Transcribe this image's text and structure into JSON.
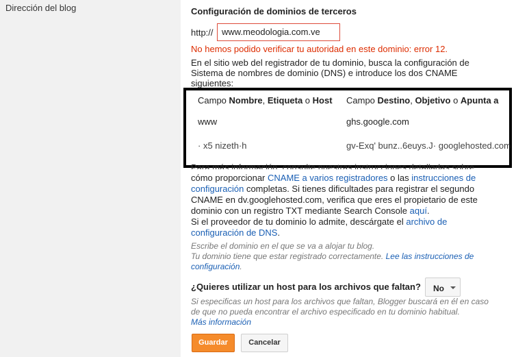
{
  "sidebar": {
    "label": "Dirección del blog"
  },
  "section": {
    "heading": "Configuración de dominios de terceros"
  },
  "domain": {
    "prefix": "http://",
    "value": "www.meodologia.com.ve"
  },
  "error": "No hemos podido verificar tu autoridad en este dominio: error 12.",
  "instructions": "En el sitio web del registrador de tu dominio, busca la configuración de Sistema de nombres de dominio (DNS) e introduce los dos CNAME siguientes:",
  "cname": {
    "header_name_prefix": "Campo ",
    "header_name_b1": "Nombre",
    "header_name_sep1": ", ",
    "header_name_b2": "Etiqueta",
    "header_name_sep2": " o ",
    "header_name_b3": "Host",
    "header_dest_prefix": "Campo ",
    "header_dest_b1": "Destino",
    "header_dest_sep1": ", ",
    "header_dest_b2": "Objetivo",
    "header_dest_sep2": " o ",
    "header_dest_b3": "Apunta a",
    "row1_name": "www",
    "row1_dest": "ghs.google.com",
    "row2_name": "· x5 nizeth·h",
    "row2_dest": "gv-Exq' bunz..6euys.J· googlehosted.com"
  },
  "more_info": {
    "cut_line": "Para más información, consulte nuestras instrucciones detalladas sobre",
    "text1": "cómo proporcionar ",
    "link1": "CNAME a varios registradores",
    "text2": " o las ",
    "link2": "instrucciones de configuración",
    "text3": " completas. Si tienes dificultades para registrar el segundo CNAME en dv.googlehosted.com, verifica que eres el propietario de este dominio con un registro TXT mediante Search Console ",
    "link3": "aquí",
    "text4": ".",
    "text5": "Si el proveedor de tu dominio lo admite, descárgate el ",
    "link4": "archivo de configuración de DNS",
    "text6": "."
  },
  "hint": {
    "line1": "Escribe el dominio en el que se va a alojar tu blog.",
    "line2": "Tu dominio tiene que estar registrado correctamente. ",
    "link": "Lee las instrucciones de configuración",
    "end": "."
  },
  "missing_files": {
    "question": "¿Quieres utilizar un host para los archivos que faltan?",
    "selected": "No",
    "note": "Si especificas un host para los archivos que faltan, Blogger buscará en él en caso de que no pueda encontrar el archivo especificado en tu dominio habitual.",
    "link": "Más información"
  },
  "buttons": {
    "save": "Guardar",
    "cancel": "Cancelar"
  },
  "colors": {
    "accent": "#f58b2b",
    "error": "#dd2c00",
    "link": "#1a5fb4"
  }
}
